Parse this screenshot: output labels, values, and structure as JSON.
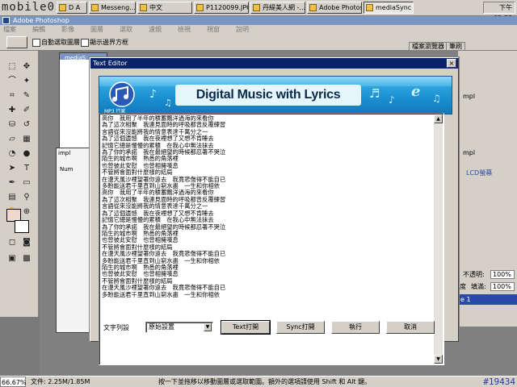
{
  "taskbar": {
    "brand": "mobile01",
    "tasks": [
      "D A",
      "Messeng...",
      "中文",
      "P1120099.JPG...",
      "丹緹美人網 -...",
      "Adobe Photos...",
      "mediaSync"
    ],
    "active_task_index": 6,
    "clock": "下午 02:38"
  },
  "photoshop": {
    "title": "Adobe Photoshop",
    "menu": [
      "檔案",
      "編輯",
      "影像",
      "圖層",
      "選取",
      "濾鏡",
      "檢視",
      "視窗",
      "說明"
    ],
    "options": {
      "auto_select_label": "自動選取圖層",
      "show_bounds_label": "顯示邊界方框"
    },
    "panel_tabs": [
      "檔案瀏覽器",
      "筆刷"
    ],
    "doc_title": "mediaS",
    "doc_label_1": "impl",
    "doc_label_2": "mpl",
    "num_label": "Num",
    "right_panel": {
      "label_1": "mpl",
      "label_2": "mpl",
      "label_3": "LCD螢幕",
      "opacity_label": "不透明:",
      "opacity_value": "100%",
      "fill_label": "填滿:",
      "fill_value": "100%",
      "degree_label": "度",
      "layer_name": "e 1"
    },
    "status": {
      "zoom": "66.67%",
      "doc_size": "文件: 2.25M/1.85M",
      "hint": "按一下並拖移以移動圖層或選取範圍。額外的選項請使用 Shift 和 Alt 鍵。"
    },
    "watermark": "#19434"
  },
  "dialog": {
    "title": "Text Editor",
    "close_glyph": "×",
    "banner_title": "Digital Music with Lyrics",
    "banner_icon_label": "MP3 行家",
    "lyrics": "高你　我用了半年的積蓄飄洋過海的來看你\n為了這次相聚　我連見面時的呼吸都曾反覆練習\n言語從來沒能將我的情意表達千萬分之一\n為了這個遺憾　我在夜裡想了又想不肯睡去\n記憶它總是慢慢的累積　在我心中無法抹去\n為了你的承諾　我在最絕望的時候都忍著不哭泣\n陌生的城市啊　熟悉的角落裡\n也曾彼此安慰　也曾相擁嘆息\n不管將會面對什麼樣的結局\n在漫天風沙裡望著你遠去　我竟悲傷得不能自已\n多盼能送君千里直到山窮水盡　一生和你相依\n高你　我用了半年的積蓄飄洋過海的來看你\n為了這次相聚　我連見面時的呼吸都曾反覆練習\n言語從來沒能將我的情意表達千萬分之一\n為了這個遺憾　我在夜裡想了又想不肯睡去\n記憶它總是慢慢的累積　在我心中無法抹去\n為了你的承諾　我在最絕望的時候都忍著不哭泣\n陌生的城市啊　熟悉的角落裡\n也曾彼此安慰　也曾相擁嘆息\n不管將會面對什麼樣的結局\n在漫天風沙裡望著你遠去　我竟悲傷得不能自已\n多盼能送君千里直到山窮水盡　一生和你相依\n陌生的城市啊　熟悉的角落裡\n也曾彼此安慰　也曾相擁嘆息\n不管將會面對什麼樣的結局\n在漫天風沙裡望著你遠去　我竟悲傷得不能自已\n多盼能送君千里直到山窮水盡　一生和你相依",
    "list_label": "文字列設",
    "preset_value": "原始設置",
    "buttons": {
      "text_open": "Text打開",
      "sync_open": "Sync打開",
      "execute": "執行",
      "cancel": "取消"
    }
  }
}
